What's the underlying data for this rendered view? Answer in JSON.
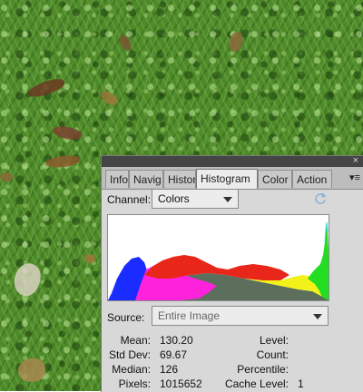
{
  "panel": {
    "tabs": [
      "Info",
      "Navig",
      "Histor",
      "Histogram",
      "Color",
      "Action"
    ],
    "active_tab": "Histogram",
    "channel_label": "Channel:",
    "channel_value": "Colors",
    "source_label": "Source:",
    "source_value": "Entire Image",
    "close_glyph": "×",
    "menu_glyph": "▾≡"
  },
  "stats": {
    "mean_label": "Mean:",
    "mean": "130.20",
    "std_dev_label": "Std Dev:",
    "std_dev": "69.67",
    "median_label": "Median:",
    "median": "126",
    "pixels_label": "Pixels:",
    "pixels": "1015652",
    "level_label": "Level:",
    "level": "",
    "count_label": "Count:",
    "count": "",
    "percentile_label": "Percentile:",
    "percentile": "",
    "cache_level_label": "Cache Level:",
    "cache_level": "1"
  },
  "colors": {
    "blue": "#1a2cff",
    "magenta": "#ff22dd",
    "red": "#e8261a",
    "yellow": "#f2f21a",
    "green": "#22dd22",
    "gray": "#5c6e5c",
    "cyan": "#33d6e8",
    "frame": "#8a8a8a",
    "panel_bg": "#d8d8d8"
  }
}
